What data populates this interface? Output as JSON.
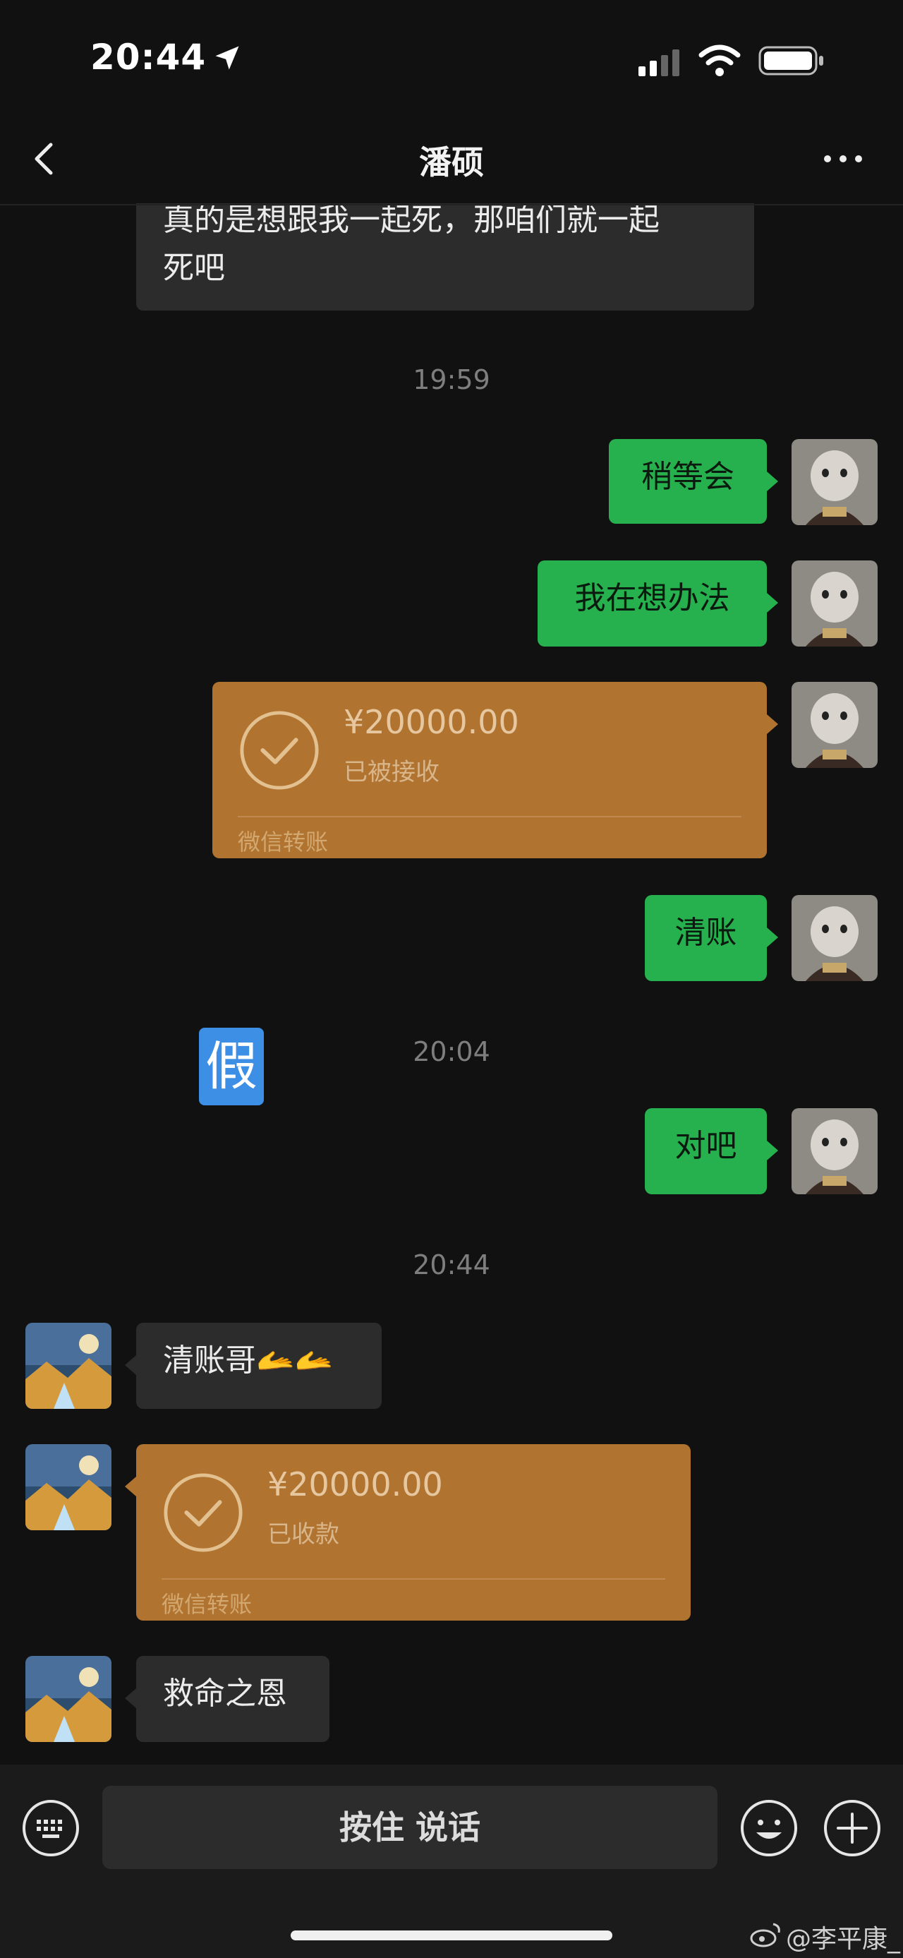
{
  "status_bar": {
    "time": "20:44"
  },
  "header": {
    "title": "潘硕"
  },
  "messages": {
    "m1": {
      "text_line1": "真的是想跟我一起死，那咱们就一起",
      "text_line2": "死吧"
    },
    "ts1": "19:59",
    "m2": "稍等会",
    "m3": "我在想办法",
    "tx1": {
      "amount": "¥20000.00",
      "status": "已被接收",
      "footer": "微信转账"
    },
    "m4": "清账",
    "fake_badge": "假",
    "ts2": "20:04",
    "m5": "对吧",
    "ts3": "20:44",
    "m6": "清账哥🫴🫴",
    "tx2": {
      "amount": "¥20000.00",
      "status": "已收款",
      "footer": "微信转账"
    },
    "m7": "救命之恩"
  },
  "bottom_bar": {
    "talk_label": "按住 说话"
  },
  "watermark": "@李平康_",
  "colors": {
    "accent_green": "#26b14e",
    "transfer_orange": "#b07330",
    "background": "#111111"
  }
}
